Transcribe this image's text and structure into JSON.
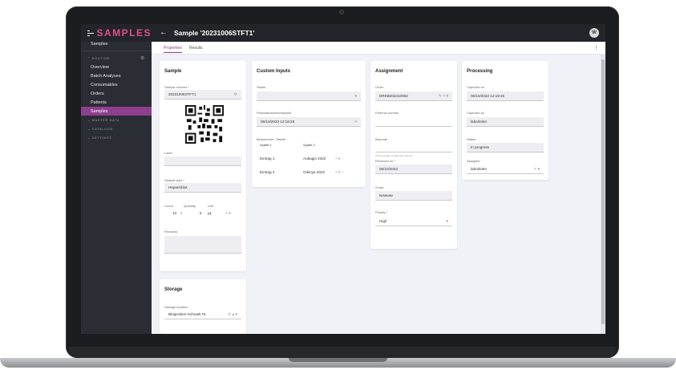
{
  "app": {
    "brand": "SAMPLES",
    "title": "Sample '20231006STFT1'",
    "user_initial": "W"
  },
  "sidebar": {
    "favorites_label": "FAVORITES",
    "favorites": [
      "Samples"
    ],
    "routine_label": "ROUTINE",
    "routine": [
      "Overview",
      "Batch Analyses",
      "Consumables",
      "Orders",
      "Patients",
      "Samples"
    ],
    "active": "Samples",
    "sections": [
      "MASTER DATA",
      "CATALOGS",
      "SETTINGS"
    ]
  },
  "tabs": [
    "Properties",
    "Results"
  ],
  "sample": {
    "title": "Sample",
    "number_label": "Sample number *",
    "number": "20231006STFT1",
    "label_label": "Label",
    "type_label": "Sample type *",
    "type": "Heparinblut",
    "count_label": "Count",
    "quantity_label": "Quantity",
    "unit_label": "Unit",
    "count": "12",
    "quantity": "6",
    "unit": "µL",
    "remarks_label": "Remarks"
  },
  "storage": {
    "title": "Storage",
    "location_label": "Storage location",
    "location": "Blutproben-Schrank #1"
  },
  "custom": {
    "title": "Custom Inputs",
    "studie_label": "Studie",
    "probe_label": "Probeabnahmezeitpunkt",
    "probe_value": "06/10/2023 12:18:25",
    "table_label": "Benutzerdef. Tabelle",
    "col1": "Spalte 1",
    "col2": "Spalte 2",
    "rows": [
      {
        "c1": "Eintrag 1",
        "c2": "Aubagio 2022"
      },
      {
        "c1": "Eintrag 2",
        "c2": "Gilenya 2022"
      }
    ]
  },
  "assignment": {
    "title": "Assignment",
    "order_label": "Order",
    "order": "DRKB202310062",
    "external_label": "External number",
    "barcode_label": "Barcode",
    "barcode_hint": "input possible via barcode scanner",
    "received_label": "Received on *",
    "received": "06/10/2023",
    "goals_label": "Goals",
    "goals": "Iwswww",
    "priority_label": "Priority *",
    "priority": "High"
  },
  "processing": {
    "title": "Processing",
    "captured_on_label": "Captured on",
    "captured_on": "06/10/2023 12:18:45",
    "captured_by_label": "Captured by",
    "captured_by": "laborleiter",
    "status_label": "Status",
    "status": "In progress",
    "assignee_label": "Assignee",
    "assignee": "laborleiter"
  },
  "colors": {
    "accent": "#8e3f8f",
    "brand": "#e0508a",
    "sidebar": "#2b2d34"
  }
}
